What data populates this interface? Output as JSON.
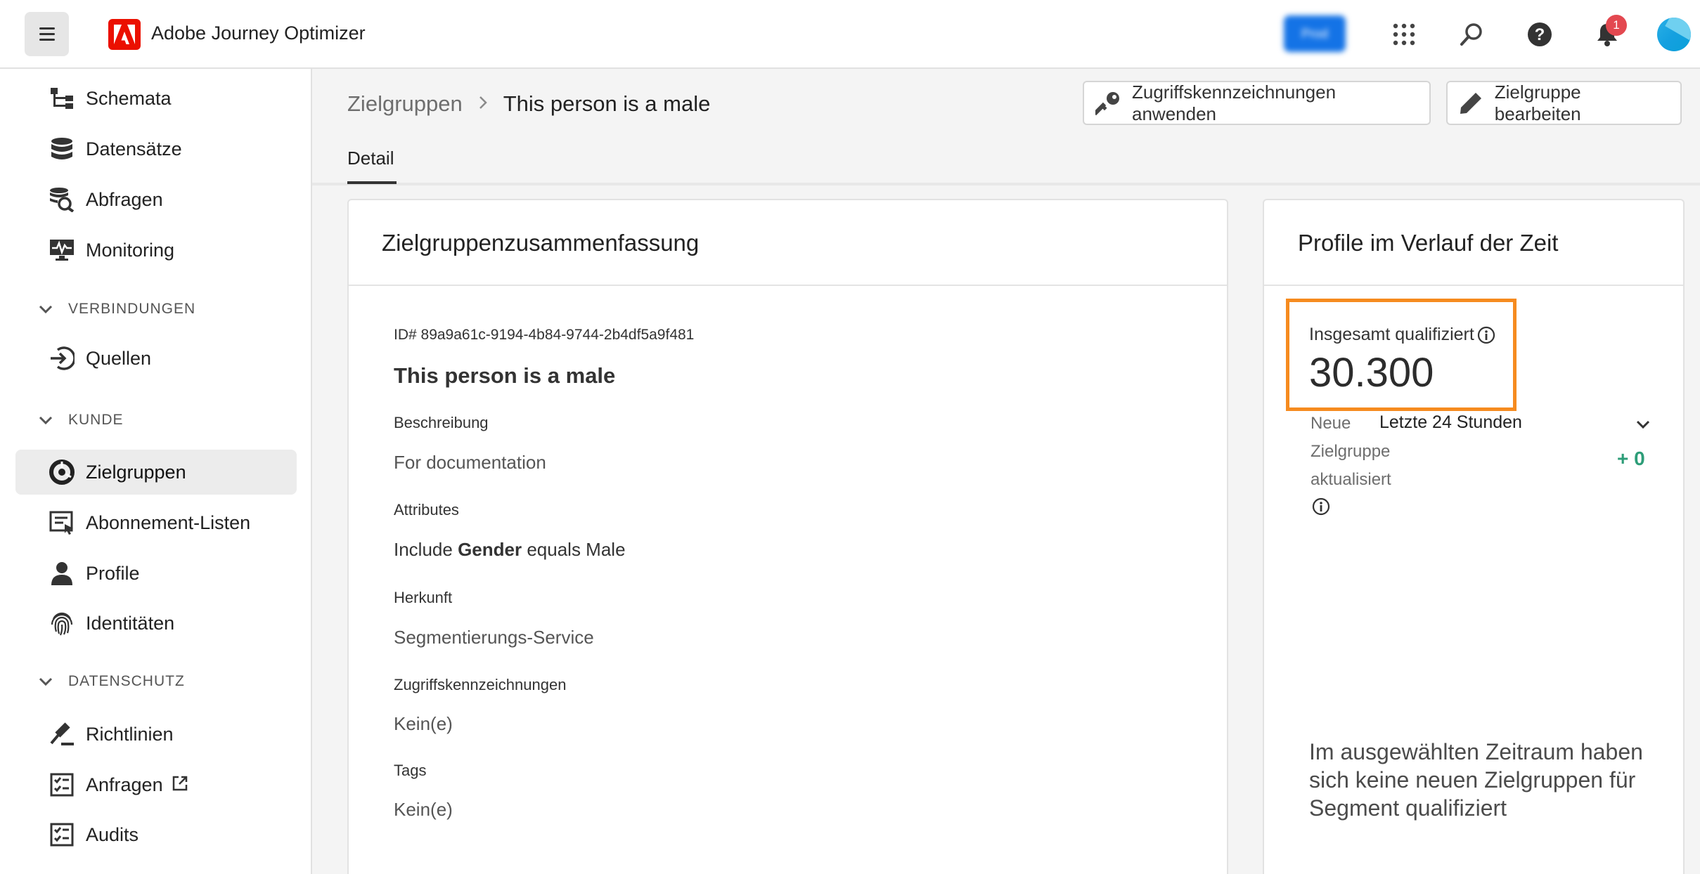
{
  "app": {
    "title": "Adobe Journey Optimizer",
    "env_badge": "Prod",
    "notification_count": "1"
  },
  "sidebar": {
    "items": [
      {
        "label": "Schemata",
        "icon": "schema-icon"
      },
      {
        "label": "Datensätze",
        "icon": "database-icon"
      },
      {
        "label": "Abfragen",
        "icon": "query-icon"
      },
      {
        "label": "Monitoring",
        "icon": "monitoring-icon"
      },
      {
        "label": "Quellen",
        "icon": "sources-icon"
      },
      {
        "label": "Zielgruppen",
        "icon": "audiences-icon",
        "active": true
      },
      {
        "label": "Abonnement-Listen",
        "icon": "subscription-list-icon"
      },
      {
        "label": "Profile",
        "icon": "profile-icon"
      },
      {
        "label": "Identitäten",
        "icon": "fingerprint-icon"
      },
      {
        "label": "Richtlinien",
        "icon": "gavel-icon"
      },
      {
        "label": "Anfragen",
        "icon": "checklist-icon"
      },
      {
        "label": "Audits",
        "icon": "checklist-icon"
      }
    ],
    "sections": {
      "connections": "VERBINDUNGEN",
      "customer": "KUNDE",
      "privacy": "DATENSCHUTZ"
    }
  },
  "breadcrumb": {
    "parent": "Zielgruppen",
    "current": "This person is a male"
  },
  "actions": {
    "apply_labels": "Zugriffskennzeichnungen anwenden",
    "edit_audience": "Zielgruppe bearbeiten"
  },
  "tabs": {
    "detail": "Detail"
  },
  "summary": {
    "title": "Zielgruppenzusammenfassung",
    "id": "ID# 89a9a61c-9194-4b84-9744-2b4df5a9f481",
    "name": "This person is a male",
    "description_label": "Beschreibung",
    "description_value": "For documentation",
    "attributes_label": "Attributes",
    "attributes_prefix": "Include ",
    "attributes_field": "Gender",
    "attributes_suffix": " equals Male",
    "origin_label": "Herkunft",
    "origin_value": "Segmentierungs-Service",
    "access_labels_label": "Zugriffskennzeichnungen",
    "access_labels_value": "Kein(e)",
    "tags_label": "Tags",
    "tags_value": "Kein(e)"
  },
  "profiles": {
    "title": "Profile im Verlauf der Zeit",
    "total_label": "Insgesamt qualifiziert",
    "total_value": "30.300",
    "new_label_1": "Neue",
    "new_label_2": "Zielgruppe",
    "new_label_3": "aktualisiert",
    "range": "Letzte 24 Stunden",
    "delta": "+ 0",
    "empty_message": "Im ausgewählten Zeitraum haben sich keine neuen Zielgruppen für Segment qualifiziert"
  },
  "colors": {
    "highlight": "#f68b1f",
    "adobe_red": "#eb1000",
    "positive": "#2d9d78",
    "notification": "#e34850"
  }
}
